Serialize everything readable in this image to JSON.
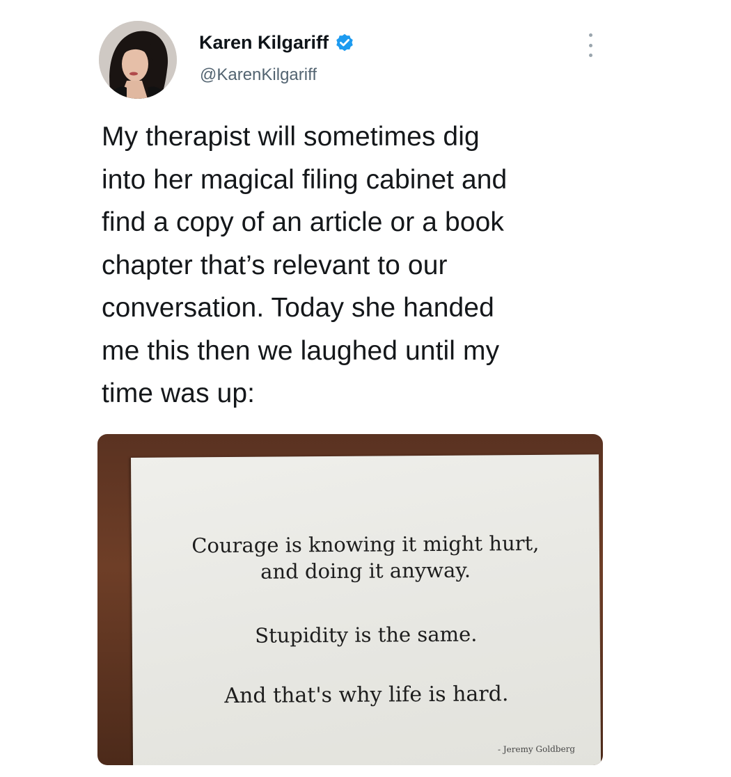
{
  "tweet": {
    "author": {
      "display_name": "Karen Kilgariff",
      "handle": "@KarenKilgariff",
      "verified": true,
      "avatar_icon": "profile-photo"
    },
    "menu_icon": "more-vertical-icon",
    "text": "My therapist will sometimes dig\ninto her magical filing cabinet and\nfind a copy of an article or a book\nchapter that’s relevant to our\nconversation. Today she handed\nme this then we laughed until my\ntime was up:",
    "media": {
      "quote_line_1": "Courage is knowing it might hurt,\nand doing it anyway.",
      "quote_line_2": "Stupidity is the same.",
      "quote_line_3": "And that's why life is hard.",
      "attribution": "- Jeremy Goldberg"
    }
  },
  "colors": {
    "verified_badge": "#1d9bf0",
    "handle_text": "#536471",
    "tweet_text": "#14171a",
    "wood_background": "#5a3221",
    "paper": "#e9e9e4"
  }
}
